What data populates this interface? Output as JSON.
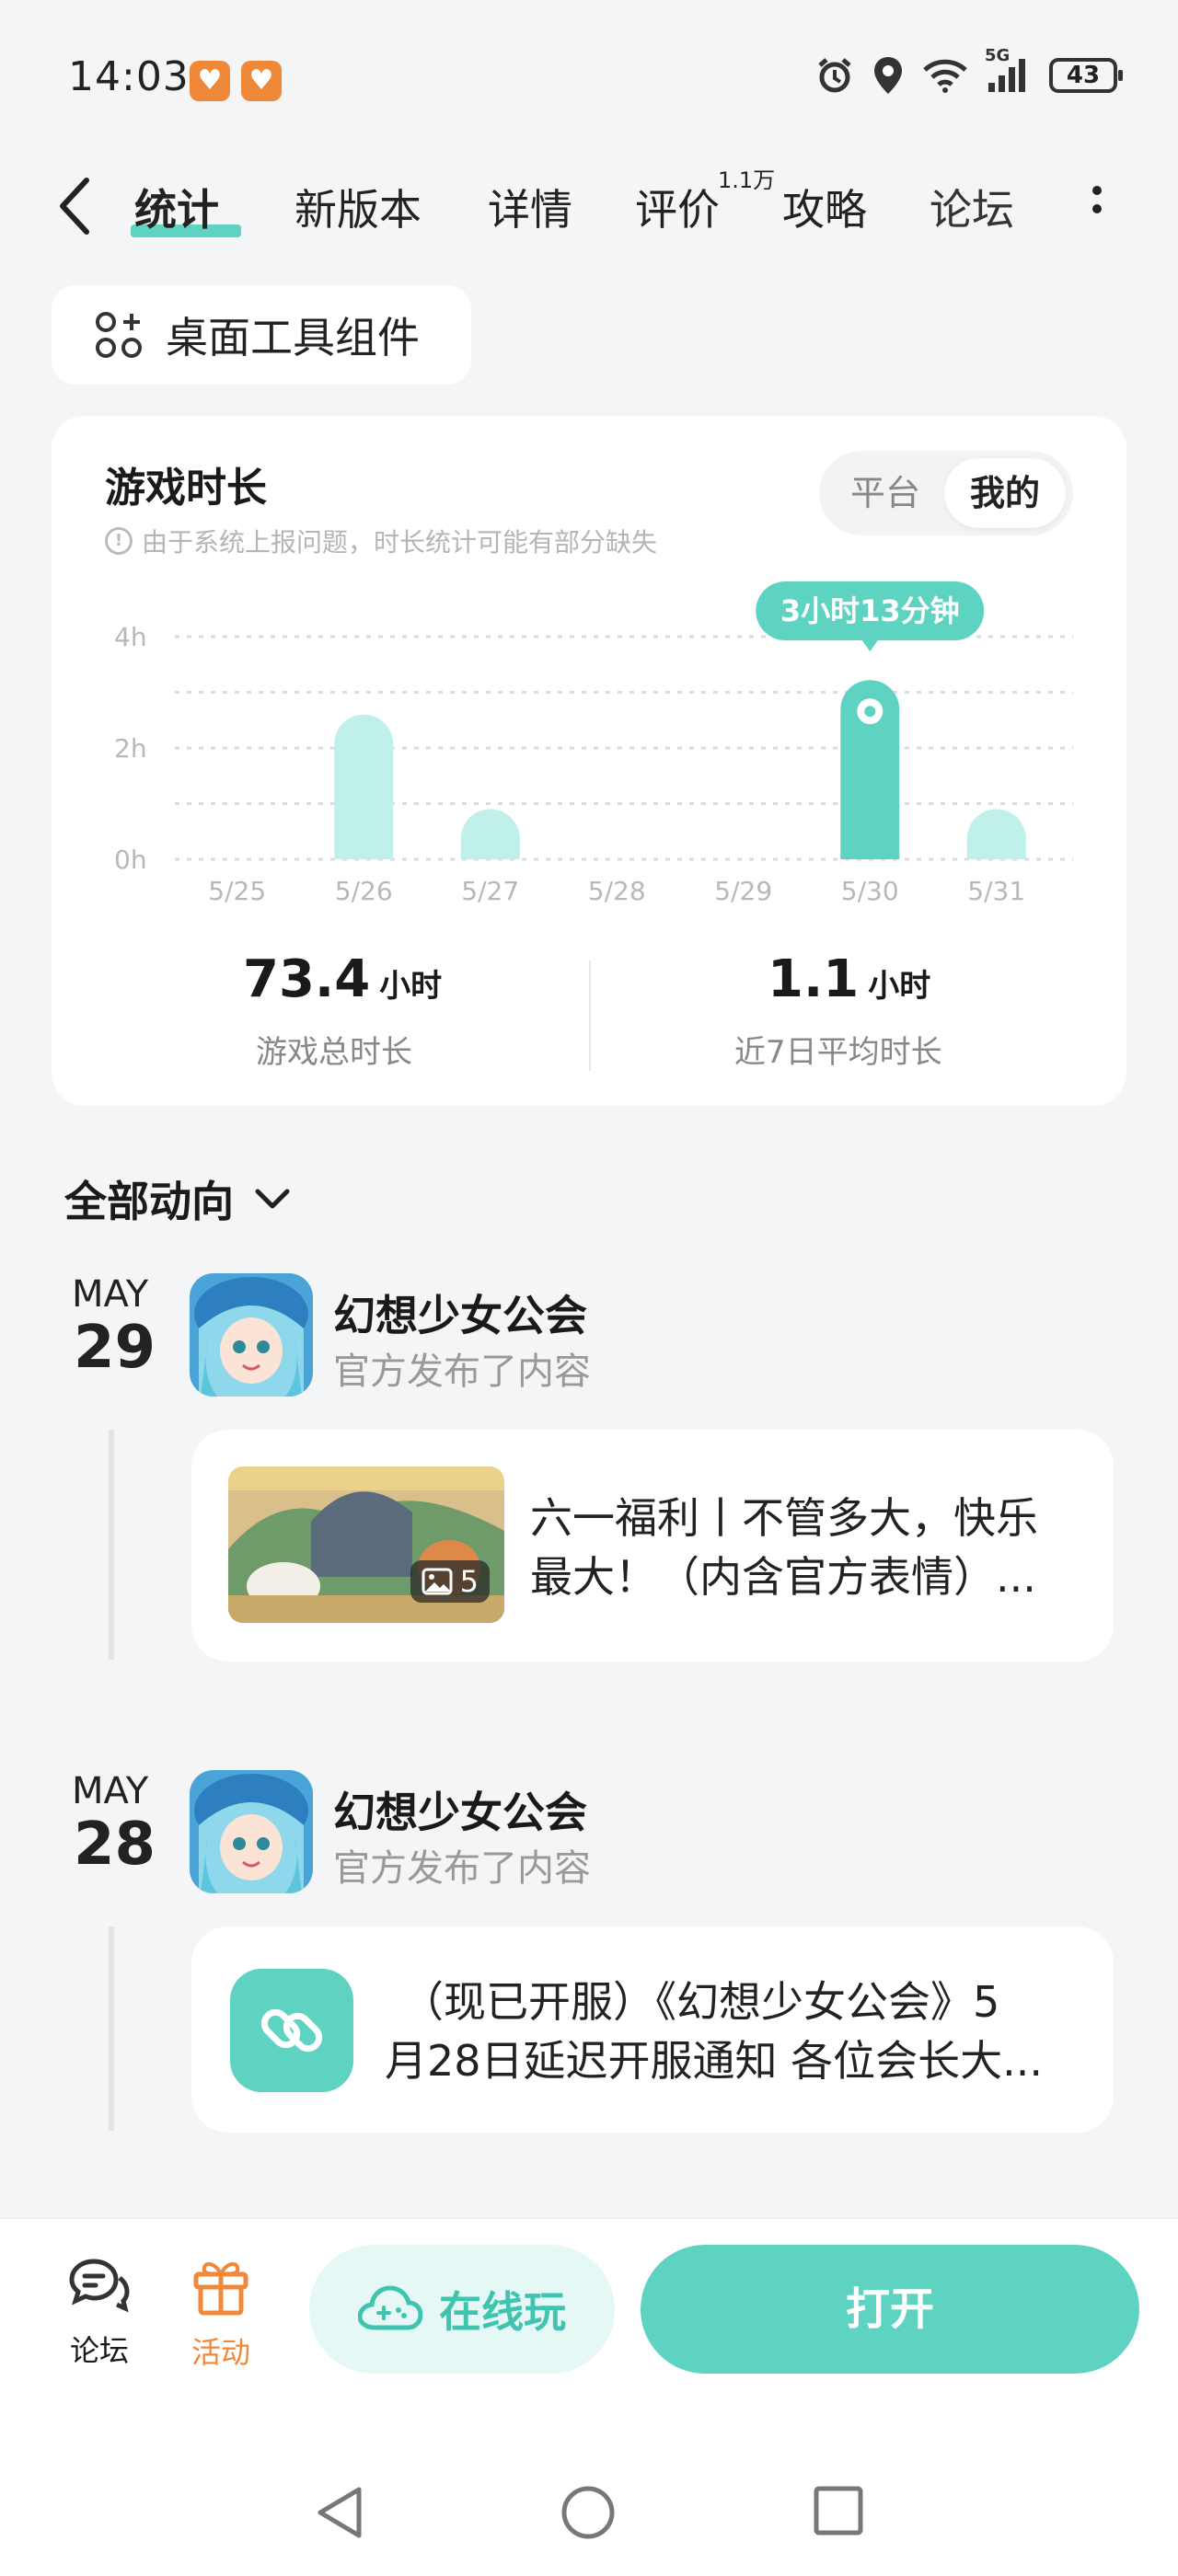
{
  "status_bar": {
    "time": "14:03",
    "network": "5G",
    "battery": "43",
    "icons": [
      "heart-app-icon",
      "heart-app-icon",
      "alarm-icon",
      "location-icon",
      "wifi-icon",
      "signal-icon",
      "battery-icon"
    ]
  },
  "tabs": [
    {
      "label": "统计",
      "active": true
    },
    {
      "label": "新版本"
    },
    {
      "label": "详情"
    },
    {
      "label": "评价",
      "badge": "1.1万"
    },
    {
      "label": "攻略"
    },
    {
      "label": "论坛"
    }
  ],
  "widget_button": {
    "label": "桌面工具组件",
    "icon": "widget-grid-icon"
  },
  "stats_card": {
    "title": "游戏时长",
    "note": "由于系统上报问题，时长统计可能有部分缺失",
    "segment": {
      "options": [
        "平台",
        "我的"
      ],
      "selected": "我的"
    },
    "tooltip": "3小时13分钟",
    "total": {
      "value": "73.4",
      "unit": "小时",
      "label": "游戏总时长"
    },
    "avg": {
      "value": "1.1",
      "unit": "小时",
      "label": "近7日平均时长"
    }
  },
  "chart_data": {
    "type": "bar",
    "categories": [
      "5/25",
      "5/26",
      "5/27",
      "5/28",
      "5/29",
      "5/30",
      "5/31"
    ],
    "values": [
      0,
      2.6,
      0.9,
      0,
      0,
      3.22,
      0.9
    ],
    "highlighted_index": 5,
    "y_ticks": [
      "0h",
      "2h",
      "4h"
    ],
    "ylim": [
      0,
      4
    ],
    "grid": true,
    "colors": {
      "bar": "#bff0ea",
      "highlight": "#5fd3c1"
    }
  },
  "feed": {
    "filter_label": "全部动向",
    "items": [
      {
        "month": "MAY",
        "day": "29",
        "publisher": "幻想少女公会",
        "action": "官方发布了内容",
        "post_line1": "六一福利丨不管多大，快乐",
        "post_line2": "最大！（内含官方表情）...",
        "image_count": "5"
      },
      {
        "month": "MAY",
        "day": "28",
        "publisher": "幻想少女公会",
        "action": "官方发布了内容",
        "post_line1": "（现已开服）《幻想少女公会》5",
        "post_line2": "月28日延迟开服通知 各位会长大..."
      }
    ]
  },
  "bottom_bar": {
    "forum_label": "论坛",
    "activity_label": "活动",
    "online_label": "在线玩",
    "open_label": "打开",
    "colors": {
      "accent": "#5fd3c1",
      "activity": "#f0883a"
    }
  }
}
